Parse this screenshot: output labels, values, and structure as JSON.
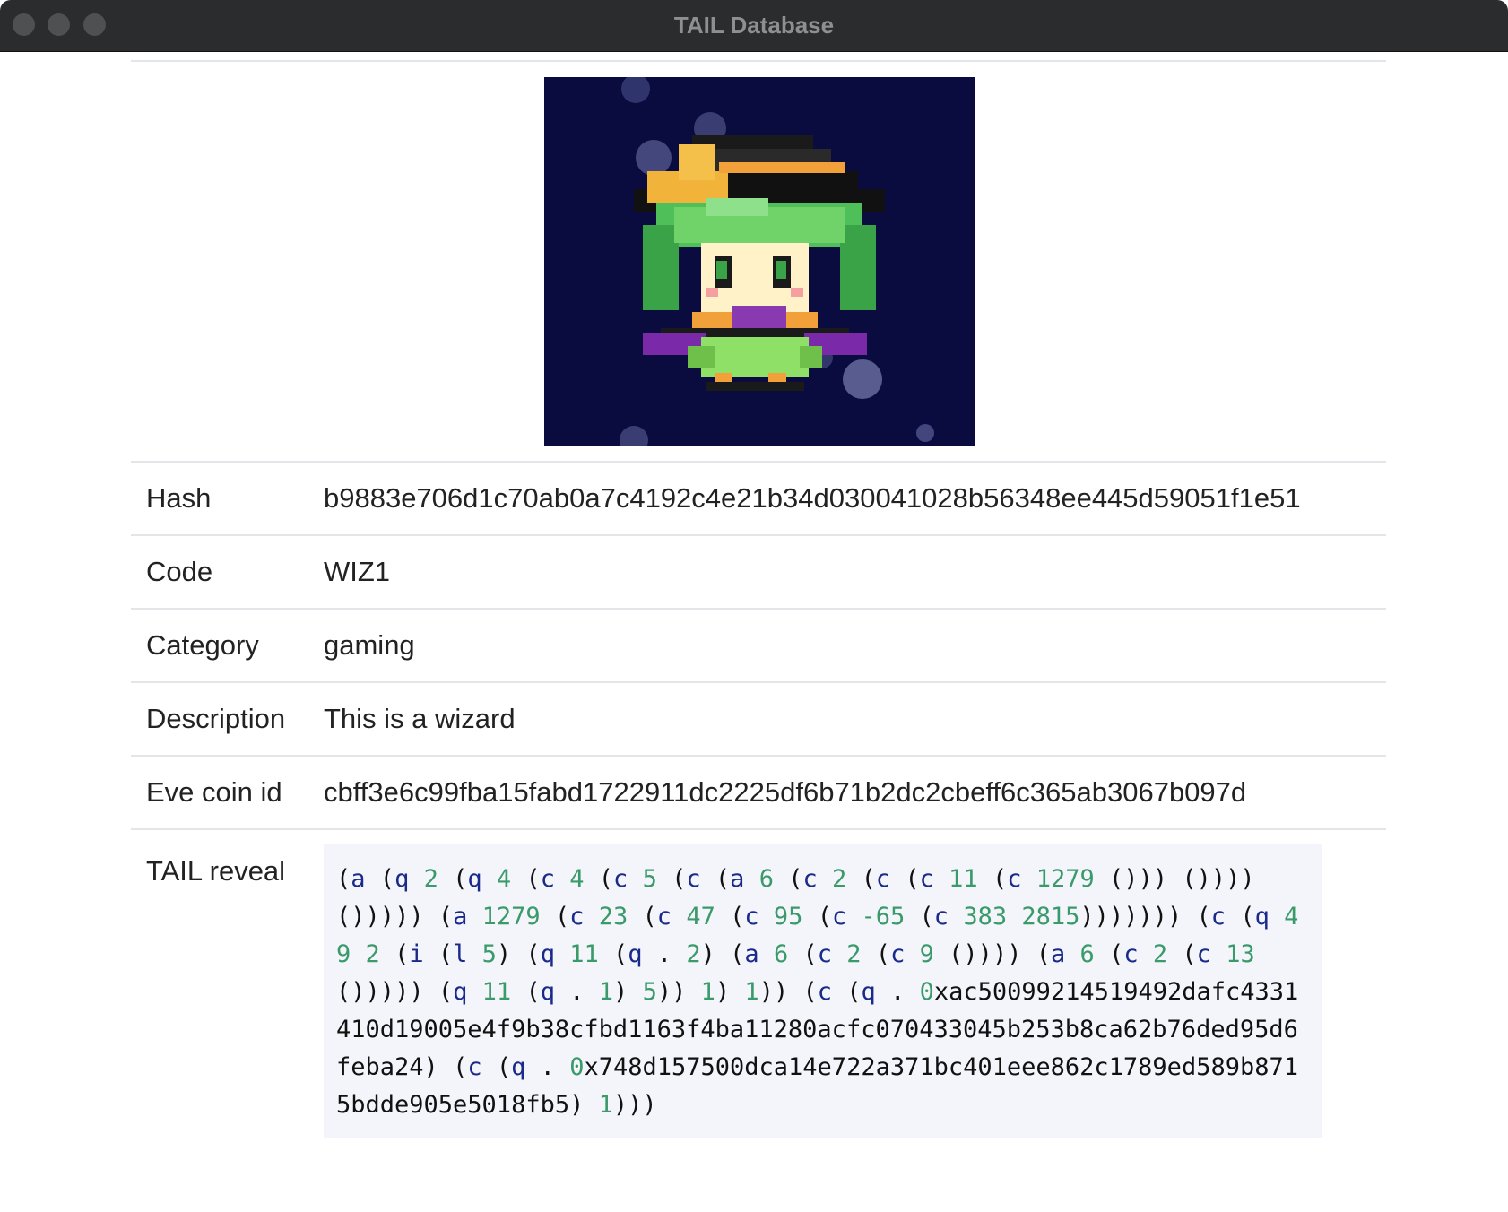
{
  "window": {
    "title": "TAIL Database"
  },
  "image": {
    "alt": "pixel-art wizard with green hair and black hat",
    "icon": "wizard-pixel-art",
    "background_color": "#0a0c40"
  },
  "details": {
    "hash": {
      "label": "Hash",
      "value": "b9883e706d1c70ab0a7c4192c4e21b34d030041028b56348ee445d59051f1e51"
    },
    "code": {
      "label": "Code",
      "value": "WIZ1"
    },
    "category": {
      "label": "Category",
      "value": "gaming"
    },
    "description": {
      "label": "Description",
      "value": "This is a wizard"
    },
    "eve_coin_id": {
      "label": "Eve coin id",
      "value": "cbff3e6c99fba15fabd1722911dc2225df6b71b2dc2cbeff6c365ab3067b097d"
    },
    "tail_reveal": {
      "label": "TAIL reveal",
      "value": "(a (q 2 (q 4 (c 4 (c 5 (c (a 6 (c 2 (c (c 11 (c 1279 ())) ()))) ())))) (a 1279 (c 23 (c 47 (c 95 (c -65 (c 383 2815))))))) (c (q 49 2 (i (l 5) (q 11 (q . 2) (a 6 (c 2 (c 9 ()))) (a 6 (c 2 (c 13 ())))) (q 11 (q . 1) 5)) 1) 1)) (c (q . 0xac50099214519492dafc4331410d19005e4f9b38cfbd1163f4ba11280acfc070433045b253b8ca62b76ded95d6feba24) (c (q . 0x748d157500dca14e722a371bc401eee862c1789ed589b8715bdde905e5018fb5) 1)))"
    }
  },
  "colors": {
    "titlebar": "#2a2c2e",
    "rule": "#e3e5e8",
    "code_bg": "#f4f5fb",
    "code_keyword": "#1a2a8a",
    "code_number": "#3a9a6a"
  }
}
